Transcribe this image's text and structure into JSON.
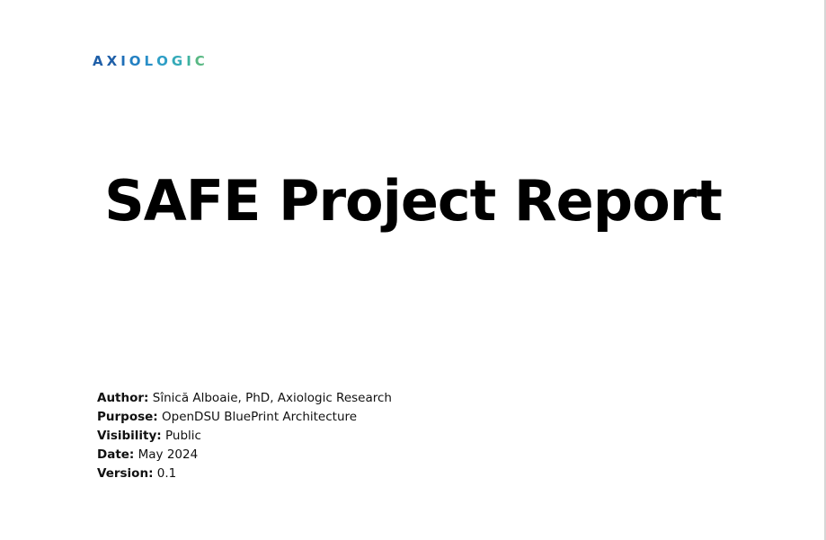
{
  "logo": {
    "letters": [
      "A",
      "X",
      "I",
      "O",
      "L",
      "O",
      "G",
      "I",
      "C"
    ],
    "colors": [
      "#1f5fa8",
      "#1f5fa8",
      "#1f6fb8",
      "#2380c2",
      "#2a8fc8",
      "#2e9ec6",
      "#34aab8",
      "#3fb39f",
      "#58b883"
    ]
  },
  "document": {
    "title": "SAFE Project Report",
    "meta": {
      "author_label": "Author:",
      "author_value": "Sînică Alboaie, PhD, Axiologic Research",
      "purpose_label": "Purpose:",
      "purpose_value": "OpenDSU BluePrint Architecture",
      "visibility_label": "Visibility:",
      "visibility_value": "Public",
      "date_label": "Date:",
      "date_value": "May 2024",
      "version_label": "Version:",
      "version_value": "0.1"
    }
  }
}
